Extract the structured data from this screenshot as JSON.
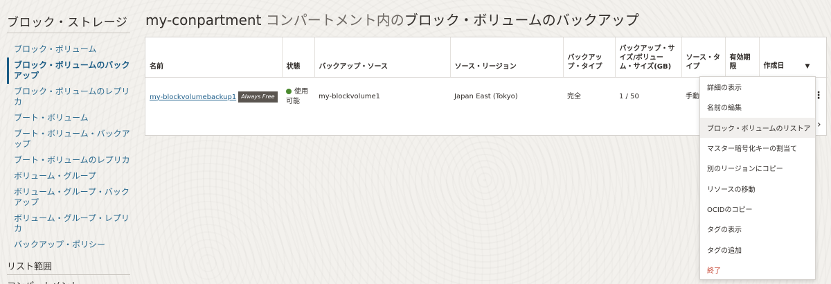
{
  "sidebar": {
    "title": "ブロック・ストレージ",
    "items": [
      "ブロック・ボリューム",
      "ブロック・ボリュームのバックアップ",
      "ブロック・ボリュームのレプリカ",
      "ブート・ボリューム",
      "ブート・ボリューム・バックアップ",
      "ブート・ボリュームのレプリカ",
      "ボリューム・グループ",
      "ボリューム・グループ・バックアップ",
      "ボリューム・グループ・レプリカ",
      "バックアップ・ポリシー"
    ],
    "section_title": "リスト範囲",
    "section_title2": "コンパートメント"
  },
  "page": {
    "compartment": "my-conpartment",
    "title_mid": " コンパートメント内の",
    "title_tail": "ブロック・ボリュームのバックアップ"
  },
  "table": {
    "headers": [
      "名前",
      "状態",
      "バックアップ・ソース",
      "ソース・リージョン",
      "バックアップ・タイプ",
      "バックアップ・サイズ/ボリューム・サイズ(GB)",
      "ソース・タイプ",
      "有効期限",
      "作成日"
    ],
    "sort_icon": "▼",
    "row": {
      "name": "my-blockvolumebackup1",
      "badge": "Always Free",
      "state": "使用可能",
      "source": "my-blockvolume1",
      "region": "Japan East (Tokyo)",
      "type": "完全",
      "size": "1 / 50",
      "source_type": "手動",
      "expiry": "",
      "created": ""
    },
    "kebab": "⋮"
  },
  "menu": {
    "items": [
      "詳細の表示",
      "名前の編集",
      "ブロック・ボリュームのリストア",
      "マスター暗号化キーの割当て",
      "別のリージョンにコピー",
      "リソースの移動",
      "OCIDのコピー",
      "タグの表示",
      "タグの追加",
      "終了"
    ],
    "submenu_arrow": "›"
  },
  "colors": {
    "accent": "#1b5c85",
    "available": "#4a8a2f",
    "danger": "#c74634"
  }
}
